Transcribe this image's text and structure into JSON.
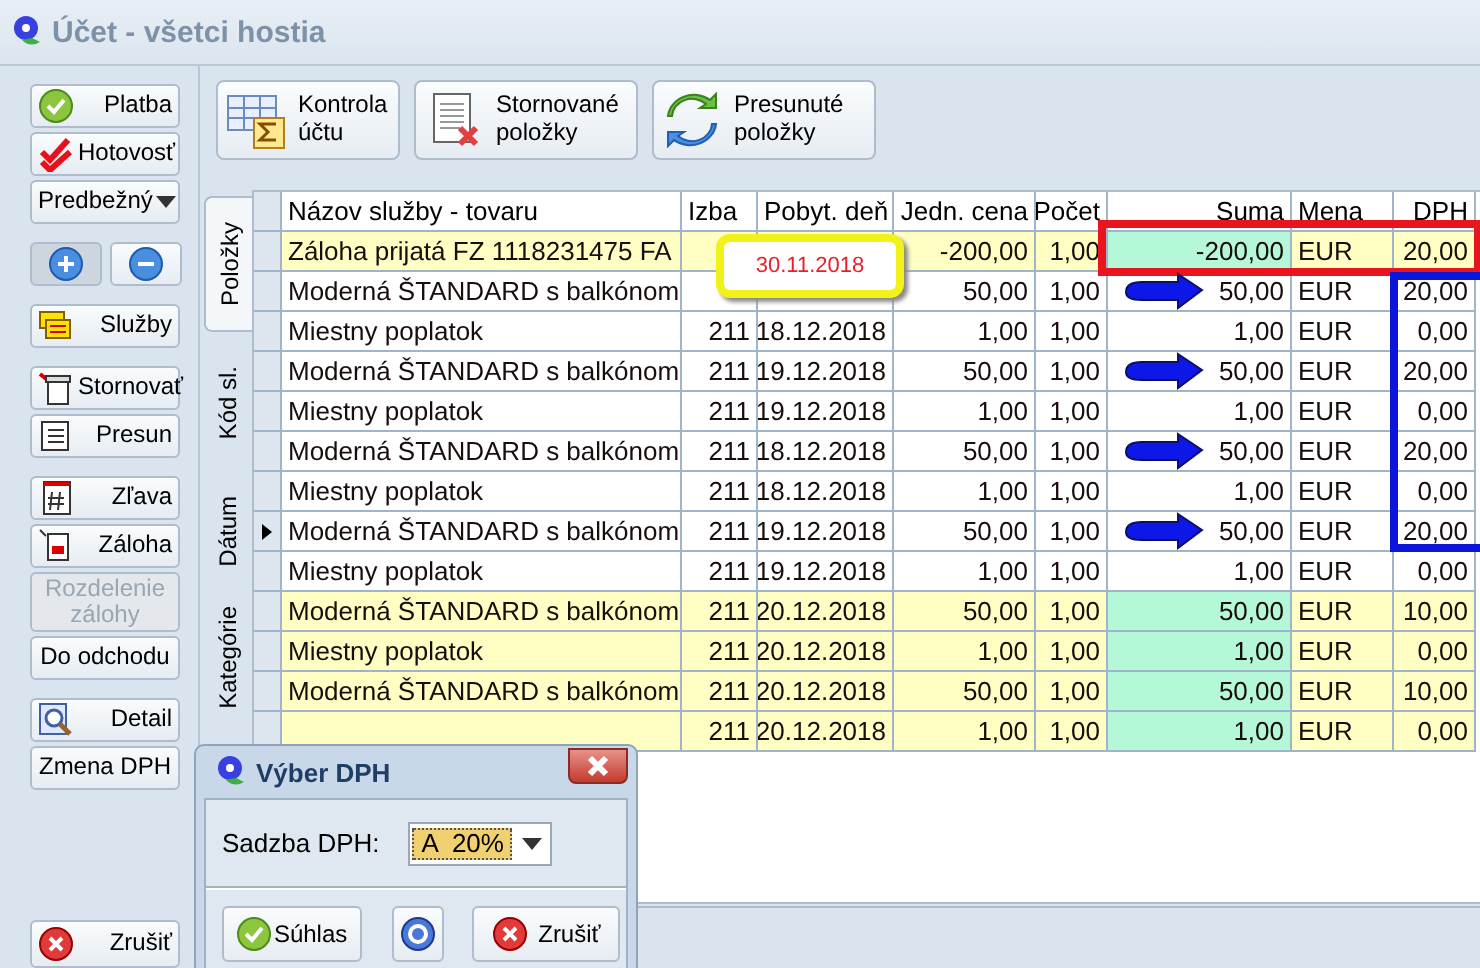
{
  "window": {
    "title": "Účet - všetci hostia"
  },
  "sidebar": {
    "buttons": [
      {
        "kind": "icon-button",
        "label": "Platba",
        "disabled": false
      },
      {
        "kind": "icon-button",
        "label": "Hotovosť",
        "disabled": false
      },
      {
        "kind": "dropdown",
        "label": "Predbežný",
        "disabled": false
      },
      {
        "kind": "pair",
        "pressed_left": true
      },
      {
        "kind": "icon-button",
        "label": "Služby",
        "disabled": false
      },
      {
        "kind": "icon-button",
        "label": "Stornovať",
        "disabled": false
      },
      {
        "kind": "icon-button",
        "label": "Presun",
        "disabled": false
      },
      {
        "kind": "icon-button",
        "label": "Zľava",
        "disabled": false
      },
      {
        "kind": "icon-button",
        "label": "Záloha",
        "disabled": false
      },
      {
        "kind": "text-button",
        "label": "Rozdelenie zálohy",
        "disabled": true
      },
      {
        "kind": "text-button",
        "label": "Do odchodu",
        "disabled": false
      },
      {
        "kind": "icon-button",
        "label": "Detail",
        "disabled": false
      },
      {
        "kind": "text-button",
        "label": "Zmena DPH",
        "disabled": false
      }
    ],
    "cancel": "Zrušiť"
  },
  "toolbar": [
    {
      "label": "Kontrola účtu"
    },
    {
      "label": "Stornované položky"
    },
    {
      "label": "Presunuté položky"
    }
  ],
  "side_tabs": [
    {
      "label": "Položky",
      "selected": true
    },
    {
      "label": "Kód sl.",
      "selected": false
    },
    {
      "label": "Dátum",
      "selected": false
    },
    {
      "label": "Kategórie",
      "selected": false
    }
  ],
  "table": {
    "columns": [
      "Názov služby - tovaru",
      "Izba",
      "Pobyt. deň",
      "Jedn. cena",
      "Počet",
      "Suma",
      "Mena",
      "DPH"
    ],
    "rows": [
      {
        "name": "Záloha prijatá FZ 1118231475 FA",
        "price": "-200,00",
        "qty": "1,00",
        "sum": "-200,00",
        "currency": "EUR",
        "vat": "20,00",
        "highlighted": true,
        "current": false,
        "boxed": true,
        "arrow": false,
        "vat_outlined": false,
        "callout": "30.11.2018"
      },
      {
        "name": "Moderná ŠTANDARD s balkónom",
        "price": "50,00",
        "qty": "1,00",
        "sum": "50,00",
        "currency": "EUR",
        "vat": "20,00",
        "highlighted": false,
        "current": false,
        "boxed": false,
        "arrow": true,
        "vat_outlined": true
      },
      {
        "name": "Miestny poplatok",
        "room": "211",
        "date": "18.12.2018",
        "price": "1,00",
        "qty": "1,00",
        "sum": "1,00",
        "currency": "EUR",
        "vat": "0,00",
        "highlighted": false,
        "current": false,
        "boxed": false,
        "arrow": false,
        "vat_outlined": true
      },
      {
        "name": "Moderná ŠTANDARD s balkónom",
        "room": "211",
        "date": "19.12.2018",
        "price": "50,00",
        "qty": "1,00",
        "sum": "50,00",
        "currency": "EUR",
        "vat": "20,00",
        "highlighted": false,
        "current": false,
        "boxed": false,
        "arrow": true,
        "vat_outlined": true
      },
      {
        "name": "Miestny poplatok",
        "room": "211",
        "date": "19.12.2018",
        "price": "1,00",
        "qty": "1,00",
        "sum": "1,00",
        "currency": "EUR",
        "vat": "0,00",
        "highlighted": false,
        "current": false,
        "boxed": false,
        "arrow": false,
        "vat_outlined": true
      },
      {
        "name": "Moderná ŠTANDARD s balkónom",
        "room": "211",
        "date": "18.12.2018",
        "price": "50,00",
        "qty": "1,00",
        "sum": "50,00",
        "currency": "EUR",
        "vat": "20,00",
        "highlighted": false,
        "current": false,
        "boxed": false,
        "arrow": true,
        "vat_outlined": true
      },
      {
        "name": "Miestny poplatok",
        "room": "211",
        "date": "18.12.2018",
        "price": "1,00",
        "qty": "1,00",
        "sum": "1,00",
        "currency": "EUR",
        "vat": "0,00",
        "highlighted": false,
        "current": false,
        "boxed": false,
        "arrow": false,
        "vat_outlined": true
      },
      {
        "name": "Moderná ŠTANDARD s balkónom",
        "room": "211",
        "date": "19.12.2018",
        "price": "50,00",
        "qty": "1,00",
        "sum": "50,00",
        "currency": "EUR",
        "vat": "20,00",
        "highlighted": false,
        "current": true,
        "boxed": false,
        "arrow": true,
        "vat_outlined": true
      },
      {
        "name": "Miestny poplatok",
        "room": "211",
        "date": "19.12.2018",
        "price": "1,00",
        "qty": "1,00",
        "sum": "1,00",
        "currency": "EUR",
        "vat": "0,00",
        "highlighted": false,
        "current": false,
        "boxed": false,
        "arrow": false,
        "vat_outlined": false
      },
      {
        "name": "Moderná ŠTANDARD s balkónom",
        "room": "211",
        "date": "20.12.2018",
        "price": "50,00",
        "qty": "1,00",
        "sum": "50,00",
        "currency": "EUR",
        "vat": "10,00",
        "highlighted": true,
        "current": false,
        "boxed": false,
        "arrow": false,
        "vat_outlined": false
      },
      {
        "name": "Miestny poplatok",
        "room": "211",
        "date": "20.12.2018",
        "price": "1,00",
        "qty": "1,00",
        "sum": "1,00",
        "currency": "EUR",
        "vat": "0,00",
        "highlighted": true,
        "current": false,
        "boxed": false,
        "arrow": false,
        "vat_outlined": false
      },
      {
        "name": "Moderná ŠTANDARD s balkónom",
        "room": "211",
        "date": "20.12.2018",
        "price": "50,00",
        "qty": "1,00",
        "sum": "50,00",
        "currency": "EUR",
        "vat": "10,00",
        "highlighted": true,
        "current": false,
        "boxed": false,
        "arrow": false,
        "vat_outlined": false
      },
      {
        "room": "211",
        "date": "20.12.2018",
        "price": "1,00",
        "qty": "1,00",
        "sum": "1,00",
        "currency": "EUR",
        "vat": "0,00",
        "highlighted": true,
        "current": false,
        "boxed": false,
        "arrow": false,
        "vat_outlined": false
      }
    ]
  },
  "dialog": {
    "title": "Výber DPH",
    "field_label": "Sadzba DPH:",
    "value": "A  20%",
    "buttons": [
      {
        "kind": "ok",
        "label": "Súhlas"
      },
      {
        "kind": "help"
      },
      {
        "kind": "cancel",
        "label": "Zrušiť"
      }
    ]
  }
}
